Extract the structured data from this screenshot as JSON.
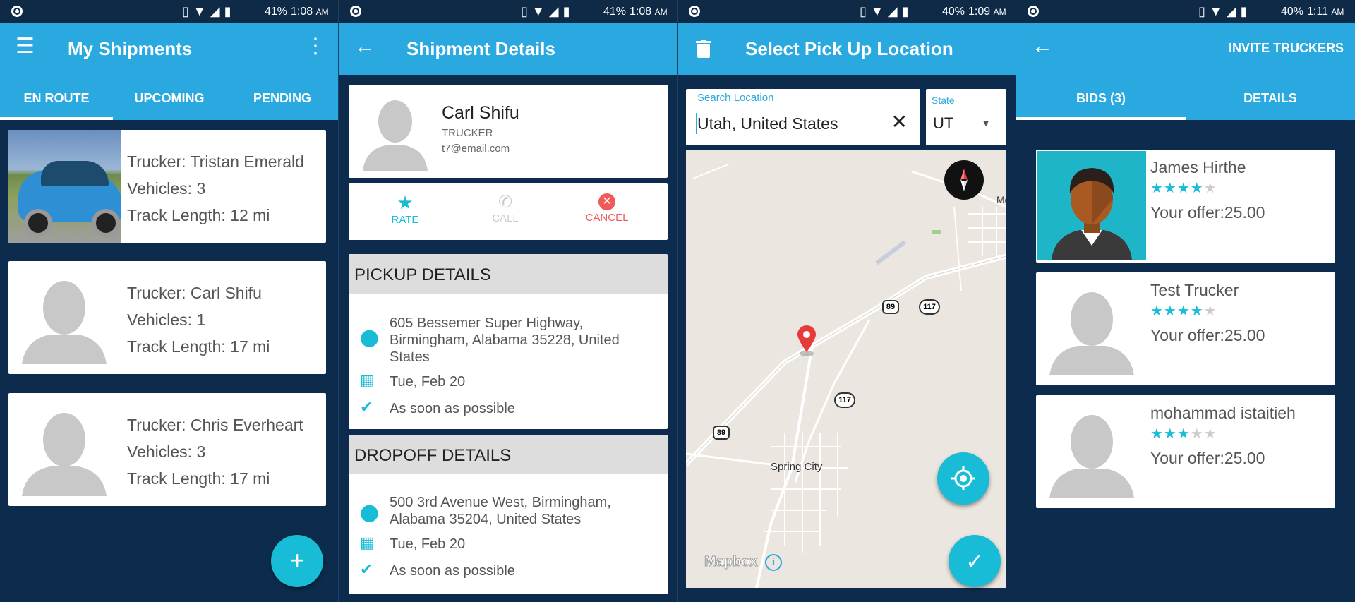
{
  "status": [
    {
      "battery": "41%",
      "time": "1:08",
      "ampm": "AM"
    },
    {
      "battery": "41%",
      "time": "1:08",
      "ampm": "AM"
    },
    {
      "battery": "40%",
      "time": "1:09",
      "ampm": "AM"
    },
    {
      "battery": "40%",
      "time": "1:11",
      "ampm": "AM"
    }
  ],
  "shipments": {
    "title": "My Shipments",
    "tabs": [
      "EN ROUTE",
      "UPCOMING",
      "PENDING"
    ],
    "cards": [
      {
        "trucker": "Trucker: Tristan Emerald",
        "vehicles": "Vehicles: 3",
        "track": "Track Length: 12 mi"
      },
      {
        "trucker": "Trucker: Carl Shifu",
        "vehicles": "Vehicles: 1",
        "track": "Track Length: 17 mi"
      },
      {
        "trucker": "Trucker: Chris Everheart",
        "vehicles": "Vehicles: 3",
        "track": "Track Length: 17 mi"
      }
    ],
    "fab": "+"
  },
  "details": {
    "title": "Shipment Details",
    "name": "Carl Shifu",
    "role": "TRUCKER",
    "email": "t7@email.com",
    "actions": {
      "rate": "RATE",
      "call": "CALL",
      "cancel": "CANCEL"
    },
    "pickup": {
      "head": "PICKUP DETAILS",
      "address": "605 Bessemer Super Highway, Birmingham, Alabama 35228, United States",
      "date": "Tue, Feb 20",
      "when": "As soon as possible"
    },
    "dropoff": {
      "head": "DROPOFF DETAILS",
      "address": "500 3rd Avenue West, Birmingham, Alabama 35204, United States",
      "date": "Tue, Feb 20",
      "when": "As soon as possible"
    }
  },
  "location": {
    "title": "Select Pick Up Location",
    "search_label": "Search Location",
    "search_value": "Utah, United States",
    "state_label": "State",
    "state_value": "UT",
    "map_labels": {
      "city": "Spring City",
      "r89": "89",
      "r117": "117",
      "mo": "Mo",
      "brand": "Mapbox"
    }
  },
  "bids": {
    "invite": "INVITE TRUCKERS",
    "tabs": [
      "BIDS (3)",
      "DETAILS"
    ],
    "items": [
      {
        "name": "James Hirthe",
        "rating": 4,
        "offer": "Your offer:25.00"
      },
      {
        "name": "Test Trucker",
        "rating": 4,
        "offer": "Your offer:25.00"
      },
      {
        "name": "mohammad istaitieh",
        "rating": 3,
        "offer": "Your offer:25.00"
      }
    ]
  },
  "colors": {
    "primary": "#29a9e0",
    "accent": "#19bcd6",
    "background": "#0d2c4d",
    "cancel": "#f05a5a"
  }
}
